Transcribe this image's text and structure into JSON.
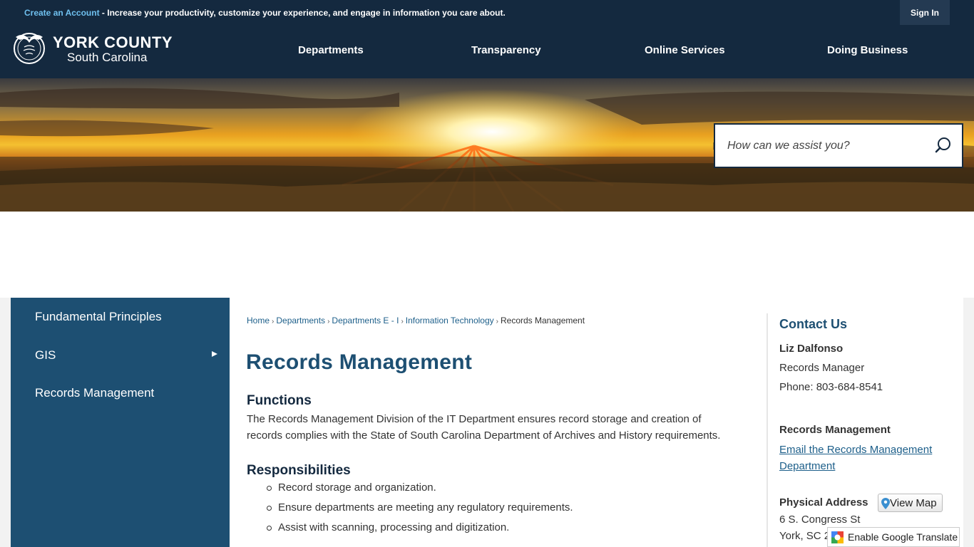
{
  "topbar": {
    "create_account_link": "Create an Account",
    "message": " - Increase your productivity, customize your experience, and engage in information you care about.",
    "sign_in": "Sign In"
  },
  "header": {
    "logo_title": "YORK COUNTY",
    "logo_subtitle": "South Carolina",
    "nav": [
      "Departments",
      "Transparency",
      "Online Services",
      "Doing Business"
    ]
  },
  "search": {
    "placeholder": "How can we assist you?"
  },
  "sidebar": {
    "items": [
      "Fundamental Principles",
      "GIS",
      "Records Management"
    ]
  },
  "breadcrumb": {
    "links": [
      "Home",
      "Departments",
      "Departments E - I",
      "Information Technology"
    ],
    "current": "Records Management"
  },
  "main": {
    "title": "Records Management",
    "functions_heading": "Functions",
    "functions_text": "The Records Management Division of the IT Department ensures record storage and creation of records complies with the State of South Carolina Department of Archives and History requirements.",
    "responsibilities_heading": "Responsibilities",
    "responsibilities": [
      "Record storage and organization.",
      "Ensure departments are meeting any regulatory requirements.",
      "Assist with scanning, processing and digitization."
    ]
  },
  "contact": {
    "heading": "Contact Us",
    "name": "Liz Dalfonso",
    "role": "Records Manager",
    "phone": "Phone: 803-684-8541",
    "dept_heading": "Records Management",
    "email_link": "Email the Records Management Department",
    "address_heading": "Physical Address",
    "view_map": "View Map",
    "address_line1": "6 S. Congress St",
    "address_line2": "York, SC 2"
  },
  "translate": {
    "label": "Enable Google Translate"
  },
  "colors": {
    "navy": "#14293f",
    "sidebar_blue": "#1d4f72",
    "link_blue": "#1d5f8a",
    "topbar_link": "#6fc0ef"
  }
}
